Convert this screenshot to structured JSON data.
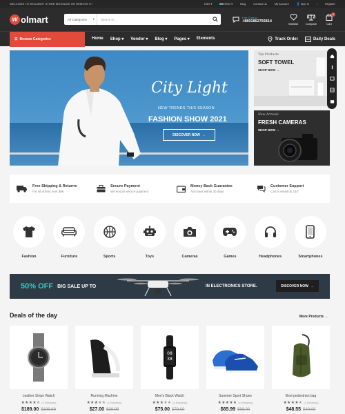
{
  "topbar": {
    "welcome": "WELCOME TO WOLMART STORE MESSAGE OR REMOVE IT!",
    "currency": "USD",
    "language": "ENG",
    "links": [
      "Blog",
      "Contact Us",
      "My Account",
      "Sign in",
      "Register"
    ],
    "sign_sep": "/"
  },
  "header": {
    "logo_mark": "w",
    "logo_text": "olmart",
    "search": {
      "category": "All Categories",
      "placeholder": "Search in..."
    },
    "contact": {
      "label": "Live Chat or:",
      "phone": "+8801862756814"
    },
    "icons": {
      "wishlist": "Wishlist",
      "compare": "Compare",
      "cart": "Cart",
      "cart_count": "0"
    }
  },
  "nav": {
    "browse": "Browse Categories",
    "menu": [
      "Home",
      "Shop",
      "Vendor",
      "Blog",
      "Pages",
      "Elements"
    ],
    "track": "Track Order",
    "daily": "Daily Deals"
  },
  "hero": {
    "title": "City Light",
    "subtitle": "NEW TRENDS THIS SEASON",
    "heading": "FASHION SHOW 2021",
    "button": "DISCOVER NOW"
  },
  "banners": [
    {
      "tag": "Top Products",
      "title": "SOFT TOWEL",
      "cta": "SHOP NOW"
    },
    {
      "tag": "New Arrivals",
      "title": "FRESH CAMERAS",
      "cta": "SHOP NOW"
    }
  ],
  "features": [
    {
      "title": "Free Shipping & Returns",
      "sub": "For all orders over $99",
      "icon": "truck-icon"
    },
    {
      "title": "Secure Payment",
      "sub": "We ensure secure payment",
      "icon": "bag-icon"
    },
    {
      "title": "Money Back Guarantee",
      "sub": "Any back within 30 days",
      "icon": "wallet-icon"
    },
    {
      "title": "Customer Support",
      "sub": "Call or email us 24/7",
      "icon": "chat-icon"
    }
  ],
  "categories": [
    "Fashion",
    "Furniture",
    "Sports",
    "Toys",
    "Cameras",
    "Games",
    "Headphones",
    "Smartphones"
  ],
  "promo": {
    "off": "50% OFF",
    "big": "BIG SALE UP TO",
    "store": "IN ELECTRONICS STORE.",
    "button": "DISCOVER NOW"
  },
  "deals": {
    "title": "Deals of the day",
    "more": "More Products",
    "products": [
      {
        "name": "Leather Stripe Watch",
        "reviews": "(1 Reviews)",
        "price": "$189.00",
        "old": "$199.89",
        "rating": 4
      },
      {
        "name": "Running Machine",
        "reviews": "(1 Reviews)",
        "price": "$27.00",
        "old": "$39.99",
        "rating": 3
      },
      {
        "name": "Men's Black Watch",
        "reviews": "(1 Reviews)",
        "price": "$75.00",
        "old": "$79.00",
        "rating": 3
      },
      {
        "name": "Summer Sport Shoes",
        "reviews": "(1 Reviews)",
        "price": "$65.99",
        "old": "$88.00",
        "rating": 5
      },
      {
        "name": "Best pedestrian bag",
        "reviews": "(1 Reviews)",
        "price": "$48.55",
        "old": "$49.00",
        "rating": 4
      }
    ]
  },
  "colors": {
    "accent": "#e24a3b",
    "dark": "#2c2c2c",
    "teal": "#3ec6c4"
  }
}
